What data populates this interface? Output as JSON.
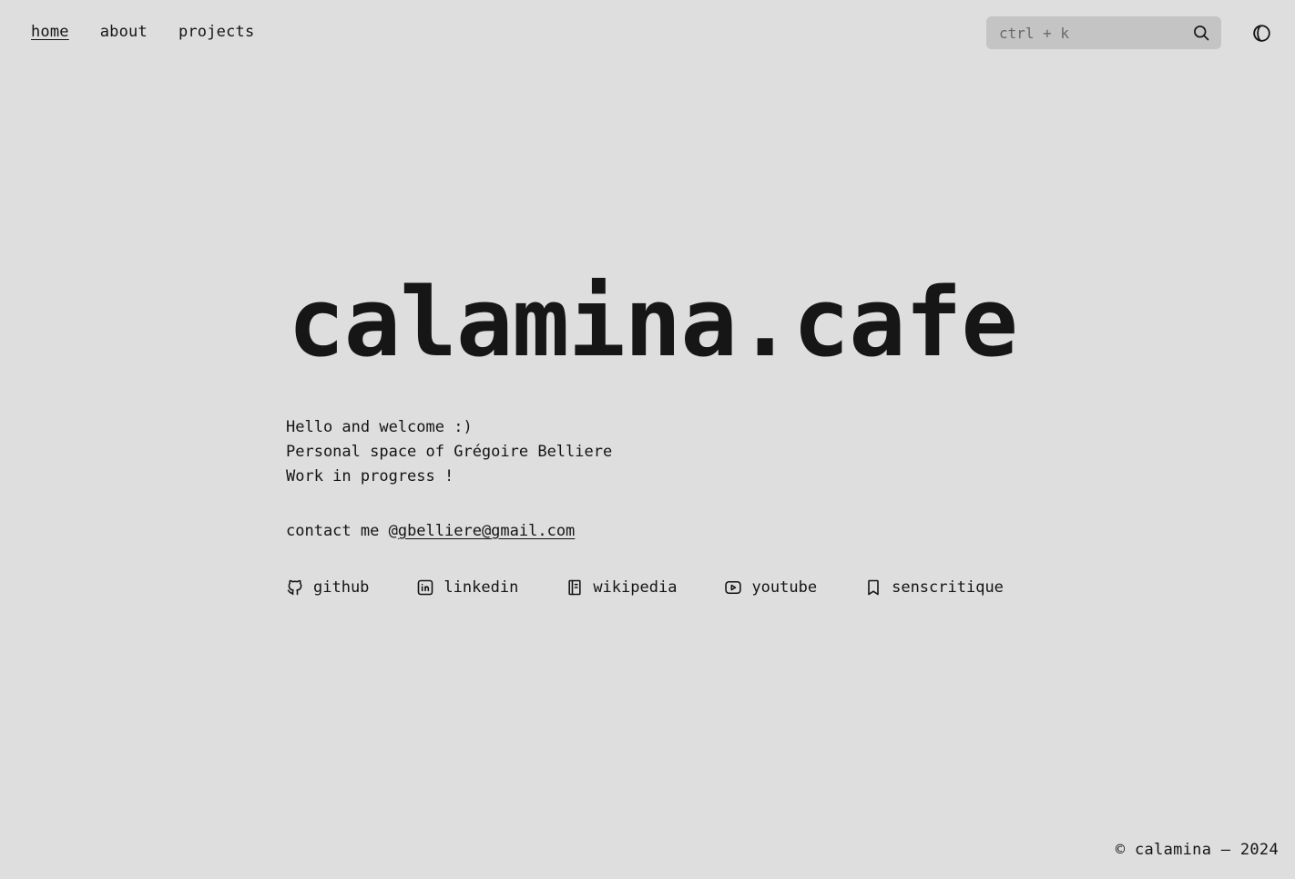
{
  "nav": {
    "home": "home",
    "about": "about",
    "projects": "projects"
  },
  "search": {
    "placeholder": "ctrl + k",
    "icon": "search-icon"
  },
  "theme_toggle": {
    "icon": "contrast-icon"
  },
  "hero": {
    "title": "calamina.cafe",
    "intro_line_1": "Hello and welcome :)",
    "intro_line_2": "Personal space of Grégoire Belliere",
    "intro_line_3": "Work in progress !",
    "contact_prefix": "contact me @",
    "contact_email": "gbelliere@gmail.com"
  },
  "links": [
    {
      "label": "github",
      "icon": "github-icon"
    },
    {
      "label": "linkedin",
      "icon": "linkedin-icon"
    },
    {
      "label": "wikipedia",
      "icon": "book-icon"
    },
    {
      "label": "youtube",
      "icon": "youtube-icon"
    },
    {
      "label": "senscritique",
      "icon": "bookmark-icon"
    }
  ],
  "footer": {
    "copyright": "© calamina – 2024"
  },
  "colors": {
    "background": "#dedede",
    "text": "#141414",
    "search_bg": "#c4c4c4"
  }
}
